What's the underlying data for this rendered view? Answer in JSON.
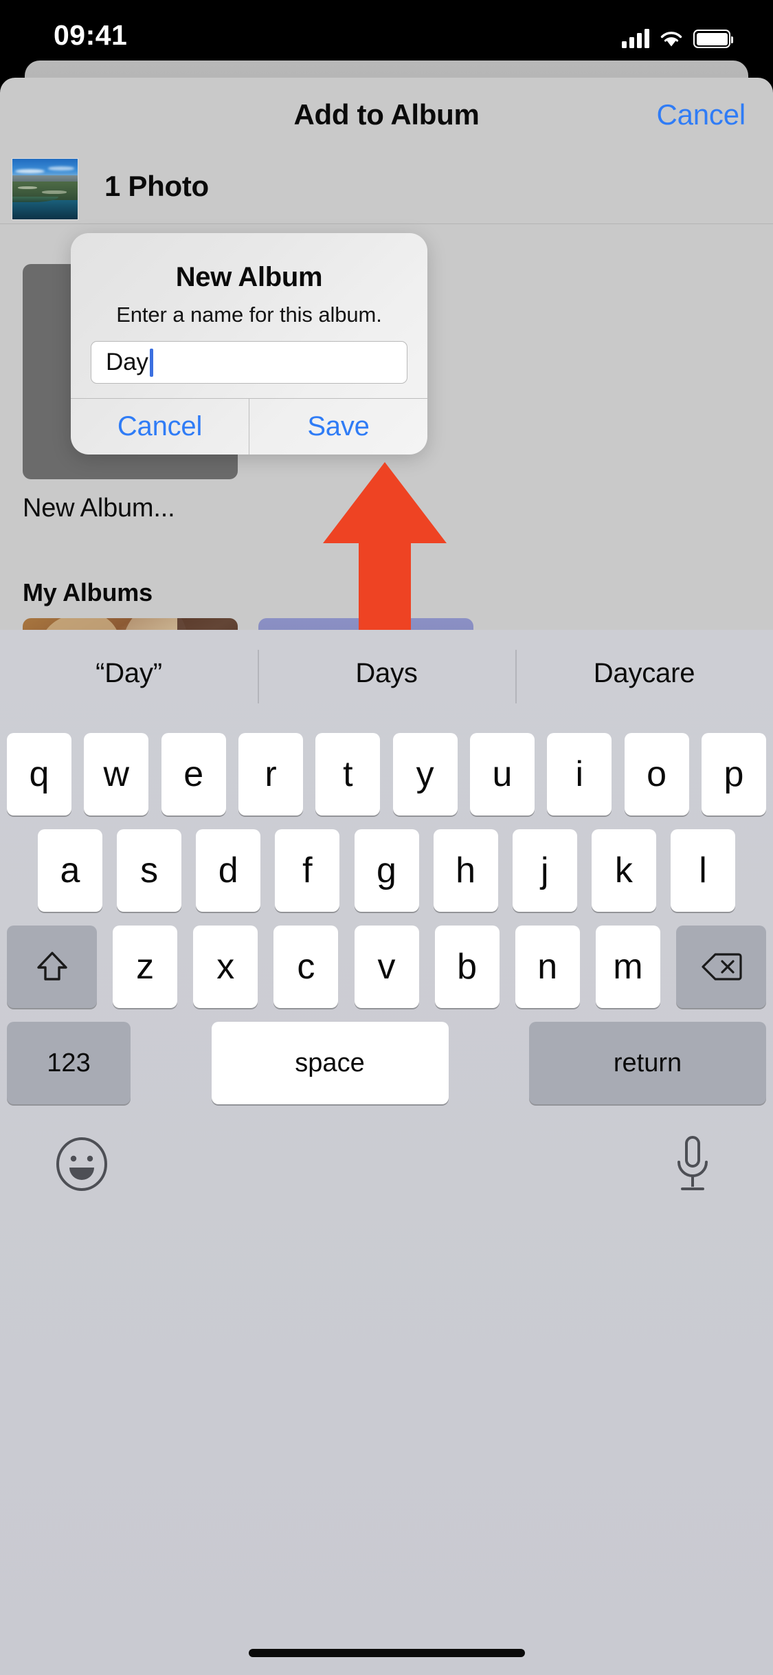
{
  "status_bar": {
    "time": "09:41",
    "cellular_icon": "signal-bars-icon",
    "wifi_icon": "wifi-icon",
    "battery_icon": "battery-icon"
  },
  "sheet": {
    "title": "Add to Album",
    "cancel_label": "Cancel",
    "photo_count": "1 Photo",
    "thumbnail_icon": "photo-thumbnail",
    "new_album_label": "New Album...",
    "my_albums_heading": "My Albums"
  },
  "alert": {
    "title": "New Album",
    "message": "Enter a name for this album.",
    "input_value": "Day",
    "input_placeholder": "",
    "cancel_label": "Cancel",
    "save_label": "Save",
    "tint_color": "#2f7cf6",
    "caret_color": "#3b6fe0"
  },
  "annotation": {
    "arrow_icon": "up-arrow-annotation",
    "arrow_color": "#ee4323"
  },
  "keyboard": {
    "suggestions": [
      "“Day”",
      "Days",
      "Daycare"
    ],
    "row1": [
      "q",
      "w",
      "e",
      "r",
      "t",
      "y",
      "u",
      "i",
      "o",
      "p"
    ],
    "row2": [
      "a",
      "s",
      "d",
      "f",
      "g",
      "h",
      "j",
      "k",
      "l"
    ],
    "row3_letters": [
      "z",
      "x",
      "c",
      "v",
      "b",
      "n",
      "m"
    ],
    "shift_icon": "shift-arrow-icon",
    "delete_icon": "delete-backspace-icon",
    "numbers_label": "123",
    "space_label": "space",
    "return_label": "return",
    "emoji_icon": "emoji-smiley-icon",
    "dictation_icon": "microphone-icon"
  },
  "home_indicator": "home-indicator-bar"
}
